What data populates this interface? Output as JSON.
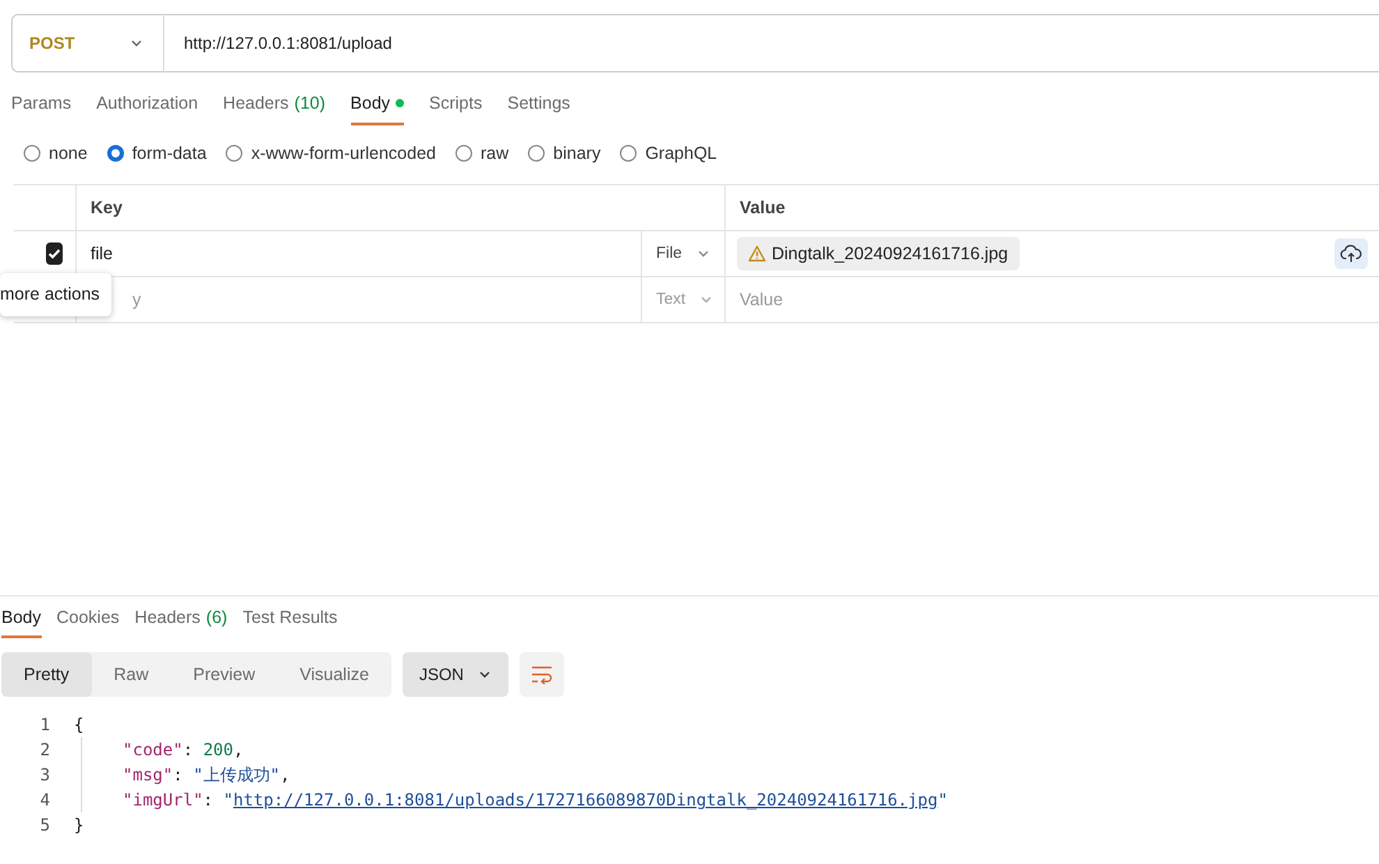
{
  "request": {
    "method": "POST",
    "url": "http://127.0.0.1:8081/upload"
  },
  "request_tabs": [
    {
      "label": "Params",
      "selected": false,
      "dot": false
    },
    {
      "label": "Authorization",
      "selected": false,
      "dot": false
    },
    {
      "label": "Headers",
      "count": "(10)",
      "selected": false,
      "dot": false
    },
    {
      "label": "Body",
      "selected": true,
      "dot": true
    },
    {
      "label": "Scripts",
      "selected": false,
      "dot": false
    },
    {
      "label": "Settings",
      "selected": false,
      "dot": false
    }
  ],
  "body_types": [
    {
      "label": "none",
      "selected": false
    },
    {
      "label": "form-data",
      "selected": true
    },
    {
      "label": "x-www-form-urlencoded",
      "selected": false
    },
    {
      "label": "raw",
      "selected": false
    },
    {
      "label": "binary",
      "selected": false
    },
    {
      "label": "GraphQL",
      "selected": false
    }
  ],
  "form_table": {
    "columns": [
      "Key",
      "Value"
    ],
    "rows": [
      {
        "kind": "file",
        "checked": true,
        "key": "file",
        "type": "File",
        "value": "Dingtalk_20240924161716.jpg"
      },
      {
        "kind": "empty",
        "key_placeholder": "y",
        "type": "Text",
        "value_placeholder": "Value"
      }
    ],
    "tooltip": "more actions"
  },
  "response_tabs": [
    {
      "label": "Body",
      "selected": true
    },
    {
      "label": "Cookies",
      "selected": false
    },
    {
      "label": "Headers",
      "count": "(6)",
      "selected": false
    },
    {
      "label": "Test Results",
      "selected": false
    }
  ],
  "view_modes": [
    {
      "label": "Pretty",
      "selected": true
    },
    {
      "label": "Raw",
      "selected": false
    },
    {
      "label": "Preview",
      "selected": false
    },
    {
      "label": "Visualize",
      "selected": false
    }
  ],
  "format": "JSON",
  "code_lines": [
    {
      "number": "1",
      "indented": false,
      "tokens": [
        {
          "kind": "punct",
          "text": "{"
        }
      ]
    },
    {
      "number": "2",
      "indented": true,
      "tokens": [
        {
          "kind": "key",
          "text": "\"code\""
        },
        {
          "kind": "punct",
          "text": ": "
        },
        {
          "kind": "number",
          "text": "200"
        },
        {
          "kind": "punct",
          "text": ","
        }
      ]
    },
    {
      "number": "3",
      "indented": true,
      "tokens": [
        {
          "kind": "key",
          "text": "\"msg\""
        },
        {
          "kind": "punct",
          "text": ": "
        },
        {
          "kind": "string",
          "text": "\"上传成功\""
        },
        {
          "kind": "punct",
          "text": ","
        }
      ]
    },
    {
      "number": "4",
      "indented": true,
      "tokens": [
        {
          "kind": "key",
          "text": "\"imgUrl\""
        },
        {
          "kind": "punct",
          "text": ": "
        },
        {
          "kind": "string",
          "text": "\""
        },
        {
          "kind": "link",
          "text": "http://127.0.0.1:8081/uploads/1727166089870Dingtalk_20240924161716.jpg"
        },
        {
          "kind": "string",
          "text": "\""
        }
      ]
    },
    {
      "number": "5",
      "indented": false,
      "tokens": [
        {
          "kind": "punct",
          "text": "}"
        }
      ]
    }
  ]
}
